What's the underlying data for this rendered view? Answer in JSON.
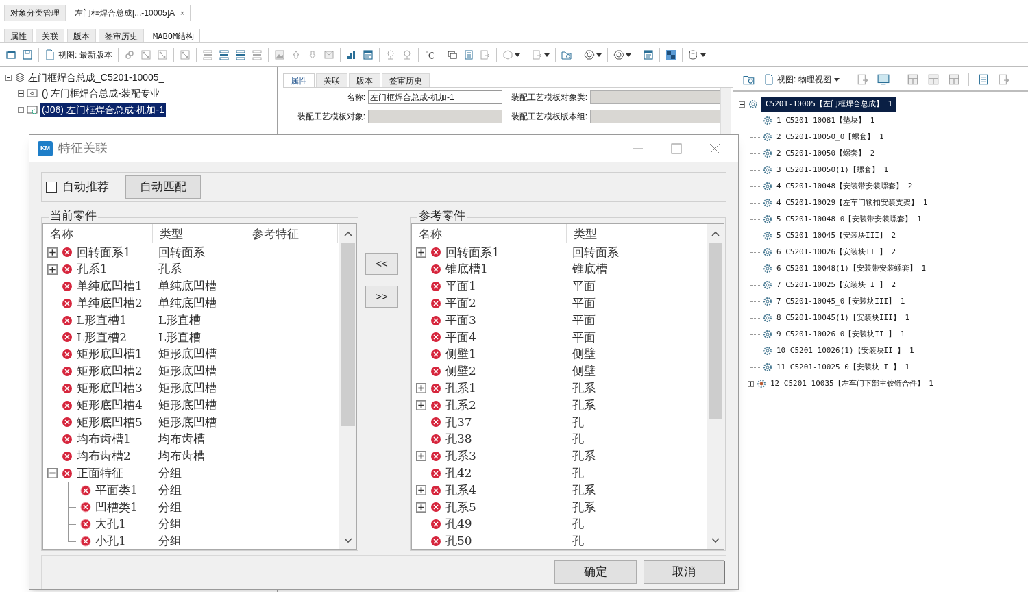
{
  "doc_tabs": [
    {
      "label": "对象分类管理",
      "selected": false
    },
    {
      "label": "左门框焊合总成[...-10005]A",
      "selected": true,
      "close": "×"
    }
  ],
  "sub_tabs": [
    {
      "label": "属性",
      "selected": false
    },
    {
      "label": "关联",
      "selected": false
    },
    {
      "label": "版本",
      "selected": false
    },
    {
      "label": "签审历史",
      "selected": false
    },
    {
      "label": "MABOM结构",
      "selected": true
    }
  ],
  "toolbar": {
    "view_label": "视图: 最新版本"
  },
  "structure_tree": {
    "label": "左门框焊合总成_C5201-10005_",
    "expanded": true,
    "children": [
      {
        "label": "() 左门框焊合总成-装配专业",
        "expanded": false,
        "selected": false
      },
      {
        "label": "(J06) 左门框焊合总成-机加-1",
        "expanded": false,
        "selected": true
      }
    ]
  },
  "properties": {
    "tabs": [
      {
        "label": "属性",
        "selected": true
      },
      {
        "label": "关联",
        "selected": false
      },
      {
        "label": "版本",
        "selected": false
      },
      {
        "label": "签审历史",
        "selected": false
      }
    ],
    "fields": [
      {
        "label": "名称:",
        "value": "左门框焊合总成-机加-1",
        "disabled": false
      },
      {
        "label": "装配工艺模板对象类:",
        "disabled": true
      },
      {
        "label": "装配工艺模板对象:",
        "disabled": true
      },
      {
        "label": "装配工艺模板版本组:",
        "disabled": true
      }
    ]
  },
  "physical_view": {
    "view_label": "视图: 物理视图",
    "tree": {
      "label": "C5201-10005【左门框焊合总成】 1",
      "expanded": true,
      "selected": true,
      "children": [
        {
          "label": "1 C5201-10081【垫块】 1",
          "kind": "part",
          "selected": false
        },
        {
          "label": "2 C5201-10050_0【螺套】 1",
          "kind": "part",
          "selected": false
        },
        {
          "label": "2 C5201-10050【螺套】 2",
          "kind": "part",
          "selected": false
        },
        {
          "label": "3 C5201-10050(1)【螺套】 1",
          "kind": "part",
          "selected": false
        },
        {
          "label": "4 C5201-10048【安装带安装螺套】 2",
          "kind": "part",
          "selected": false
        },
        {
          "label": "4 C5201-10029【左车门锁扣安装支架】 1",
          "kind": "part",
          "selected": false
        },
        {
          "label": "5 C5201-10048_0【安装带安装螺套】 1",
          "kind": "part",
          "selected": false
        },
        {
          "label": "5 C5201-10045【安装块III】 2",
          "kind": "part",
          "selected": false
        },
        {
          "label": "6 C5201-10026【安装块II 】 2",
          "kind": "part",
          "selected": false
        },
        {
          "label": "6 C5201-10048(1)【安装带安装螺套】 1",
          "kind": "part",
          "selected": false
        },
        {
          "label": "7 C5201-10025【安装块 I 】 2",
          "kind": "part",
          "selected": false
        },
        {
          "label": "7 C5201-10045_0【安装块III】 1",
          "kind": "part",
          "selected": false
        },
        {
          "label": "8 C5201-10045(1)【安装块III】 1",
          "kind": "part",
          "selected": false
        },
        {
          "label": "9 C5201-10026_0【安装块II 】 1",
          "kind": "part",
          "selected": false
        },
        {
          "label": "10 C5201-10026(1)【安装块II 】 1",
          "kind": "part",
          "selected": false
        },
        {
          "label": "11 C5201-10025_0【安装块 I 】 1",
          "kind": "part",
          "selected": false
        },
        {
          "label": "12 C5201-10035【左车门下部主铰链合件】 1",
          "kind": "assembly",
          "expanded": false,
          "selected": false
        }
      ]
    }
  },
  "dialog": {
    "logo": "KM",
    "title": "特征关联",
    "auto_recommend": {
      "label": "自动推荐",
      "checked": false
    },
    "auto_match_button": "自动匹配",
    "current_part": {
      "title": "当前零件",
      "columns": [
        "名称",
        "类型",
        "参考特征"
      ],
      "rows": [
        {
          "name": "回转面系1",
          "type": "回转面系",
          "expanded": false
        },
        {
          "name": "孔系1",
          "type": "孔系",
          "expanded": false
        },
        {
          "name": "单纯底凹槽1",
          "type": "单纯底凹槽"
        },
        {
          "name": "单纯底凹槽2",
          "type": "单纯底凹槽"
        },
        {
          "name": "L形直槽1",
          "type": "L形直槽"
        },
        {
          "name": "L形直槽2",
          "type": "L形直槽"
        },
        {
          "name": "矩形底凹槽1",
          "type": "矩形底凹槽"
        },
        {
          "name": "矩形底凹槽2",
          "type": "矩形底凹槽"
        },
        {
          "name": "矩形底凹槽3",
          "type": "矩形底凹槽"
        },
        {
          "name": "矩形底凹槽4",
          "type": "矩形底凹槽"
        },
        {
          "name": "矩形底凹槽5",
          "type": "矩形底凹槽"
        },
        {
          "name": "均布齿槽1",
          "type": "均布齿槽"
        },
        {
          "name": "均布齿槽2",
          "type": "均布齿槽"
        },
        {
          "name": "正面特征",
          "type": "分组",
          "expanded": true,
          "children": [
            {
              "name": "平面类1",
              "type": "分组"
            },
            {
              "name": "凹槽类1",
              "type": "分组"
            },
            {
              "name": "大孔1",
              "type": "分组"
            },
            {
              "name": "小孔1",
              "type": "分组"
            }
          ]
        }
      ]
    },
    "move_left_button": "<<",
    "move_right_button": ">>",
    "reference_part": {
      "title": "参考零件",
      "columns": [
        "名称",
        "类型"
      ],
      "rows": [
        {
          "name": "回转面系1",
          "type": "回转面系",
          "expanded": false
        },
        {
          "name": "锥底槽1",
          "type": "锥底槽"
        },
        {
          "name": "平面1",
          "type": "平面"
        },
        {
          "name": "平面2",
          "type": "平面"
        },
        {
          "name": "平面3",
          "type": "平面"
        },
        {
          "name": "平面4",
          "type": "平面"
        },
        {
          "name": "侧壁1",
          "type": "侧壁"
        },
        {
          "name": "侧壁2",
          "type": "侧壁"
        },
        {
          "name": "孔系1",
          "type": "孔系",
          "expanded": false
        },
        {
          "name": "孔系2",
          "type": "孔系",
          "expanded": false
        },
        {
          "name": "孔37",
          "type": "孔"
        },
        {
          "name": "孔38",
          "type": "孔"
        },
        {
          "name": "孔系3",
          "type": "孔系",
          "expanded": false
        },
        {
          "name": "孔42",
          "type": "孔"
        },
        {
          "name": "孔系4",
          "type": "孔系",
          "expanded": false
        },
        {
          "name": "孔系5",
          "type": "孔系",
          "expanded": false
        },
        {
          "name": "孔49",
          "type": "孔"
        },
        {
          "name": "孔50",
          "type": "孔"
        }
      ]
    },
    "ok_button": "确定",
    "cancel_button": "取消"
  }
}
